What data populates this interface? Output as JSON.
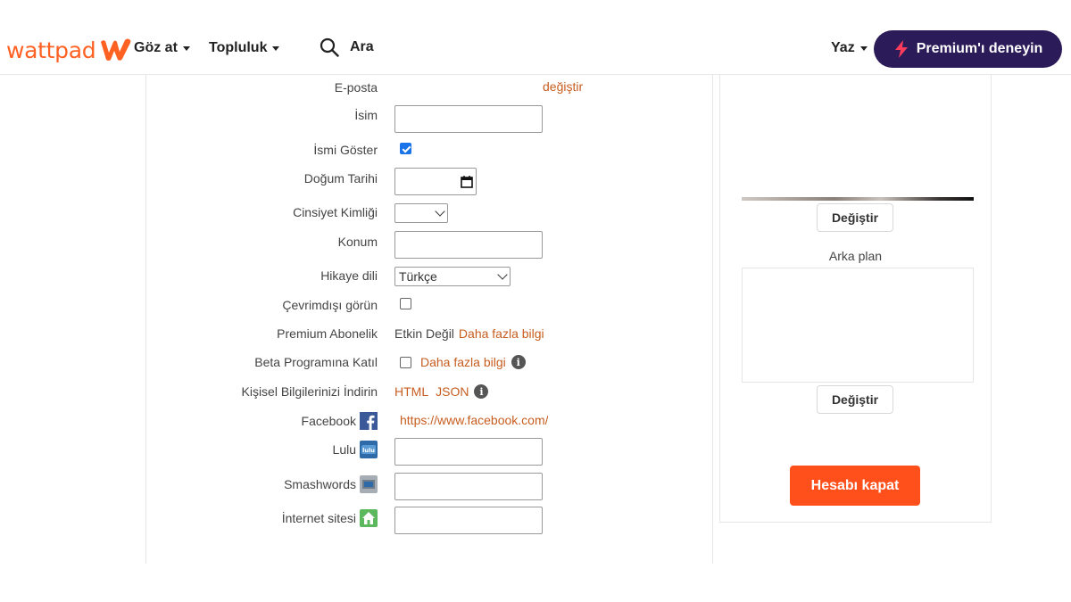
{
  "header": {
    "logo_text": "wattpad",
    "nav": [
      {
        "label": "Göz at"
      },
      {
        "label": "Topluluk"
      }
    ],
    "search": {
      "placeholder": "Ara",
      "icon": "search-icon"
    },
    "write_label": "Yaz",
    "premium_label": "Premium'ı deneyin",
    "brand_color": "#ff6122",
    "premium_color": "#2b1b59"
  },
  "form": {
    "email": {
      "label": "E-posta",
      "action": "değiştir"
    },
    "name": {
      "label": "İsim",
      "value": ""
    },
    "show_name": {
      "label": "İsmi Göster",
      "checked": true
    },
    "birthday": {
      "label": "Doğum Tarihi",
      "value": ""
    },
    "gender": {
      "label": "Cinsiyet Kimliği",
      "value": ""
    },
    "location": {
      "label": "Konum",
      "value": ""
    },
    "story_language": {
      "label": "Hikaye dili",
      "value": "Türkçe"
    },
    "appear_offline": {
      "label": "Çevrimdışı görün",
      "checked": false
    },
    "premium": {
      "label": "Premium Abonelik",
      "status": "Etkin Değil",
      "link": "Daha fazla bilgi"
    },
    "beta": {
      "label": "Beta Programına Katıl",
      "checked": false,
      "link": "Daha fazla bilgi"
    },
    "download": {
      "label": "Kişisel Bilgilerinizi İndirin",
      "html": "HTML",
      "json": "JSON"
    },
    "facebook": {
      "label": "Facebook",
      "value": "https://www.facebook.com/"
    },
    "lulu": {
      "label": "Lulu",
      "value": ""
    },
    "smashwords": {
      "label": "Smashwords",
      "value": ""
    },
    "website": {
      "label": "İnternet sitesi",
      "value": ""
    }
  },
  "side": {
    "change_label": "Değiştir",
    "background_label": "Arka plan",
    "close_account_label": "Hesabı kapat",
    "close_color": "#ff4f1a"
  }
}
